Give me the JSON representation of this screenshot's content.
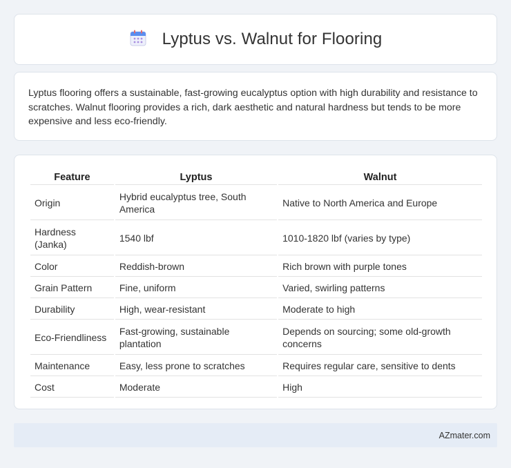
{
  "header": {
    "title": "Lyptus vs. Walnut for Flooring",
    "icon": "calendar-icon"
  },
  "intro": {
    "text": "Lyptus flooring offers a sustainable, fast-growing eucalyptus option with high durability and resistance to scratches. Walnut flooring provides a rich, dark aesthetic and natural hardness but tends to be more expensive and less eco-friendly."
  },
  "table": {
    "headers": [
      "Feature",
      "Lyptus",
      "Walnut"
    ],
    "rows": [
      [
        "Origin",
        "Hybrid eucalyptus tree, South America",
        "Native to North America and Europe"
      ],
      [
        "Hardness (Janka)",
        "1540 lbf",
        "1010-1820 lbf (varies by type)"
      ],
      [
        "Color",
        "Reddish-brown",
        "Rich brown with purple tones"
      ],
      [
        "Grain Pattern",
        "Fine, uniform",
        "Varied, swirling patterns"
      ],
      [
        "Durability",
        "High, wear-resistant",
        "Moderate to high"
      ],
      [
        "Eco-Friendliness",
        "Fast-growing, sustainable plantation",
        "Depends on sourcing; some old-growth concerns"
      ],
      [
        "Maintenance",
        "Easy, less prone to scratches",
        "Requires regular care, sensitive to dents"
      ],
      [
        "Cost",
        "Moderate",
        "High"
      ]
    ]
  },
  "footer": {
    "brand": "AZmater.com"
  },
  "colors": {
    "background": "#f0f3f7",
    "card": "#ffffff",
    "footer": "#e5ecf6",
    "icon_accent": "#5b8def"
  }
}
